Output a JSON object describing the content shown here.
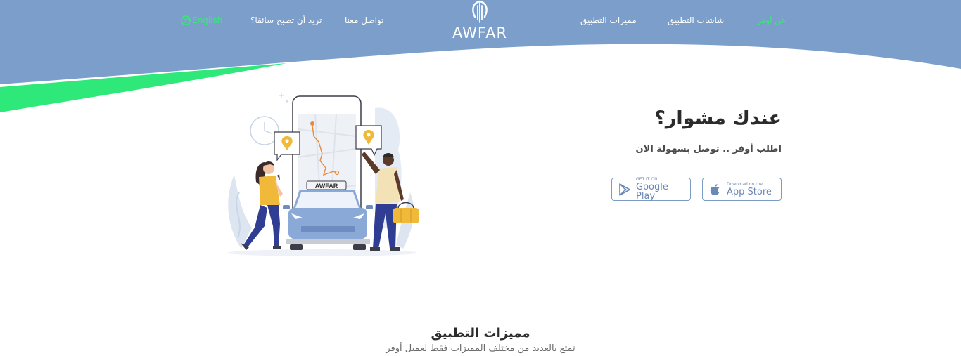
{
  "nav": {
    "about": "عن أوفر",
    "screens": "شاشات التطبيق",
    "features": "مميزات التطبيق",
    "contact": "تواصل معنا",
    "become_driver": "تريد أن تصبح سائقا؟",
    "language": "English"
  },
  "logo": {
    "text": "AWFAR"
  },
  "hero": {
    "title": "عندك مشوار؟",
    "subtitle": "اطلب أوفر .. توصل بسهولة الان"
  },
  "stores": {
    "appstore_small": "Download on the",
    "appstore_big": "App Store",
    "googleplay_small": "GET IT ON",
    "googleplay_big": "Google Play"
  },
  "illustration": {
    "car_label": "AWFAR"
  },
  "section": {
    "title": "مميزات التطبيق",
    "subtitle": "تمتع بالعديد من مختلف المميزات فقط لعميل أوفر"
  },
  "colors": {
    "header_blue": "#7b9fca",
    "accent_green": "#3ce67a",
    "stripe_green": "#2ee87a"
  }
}
